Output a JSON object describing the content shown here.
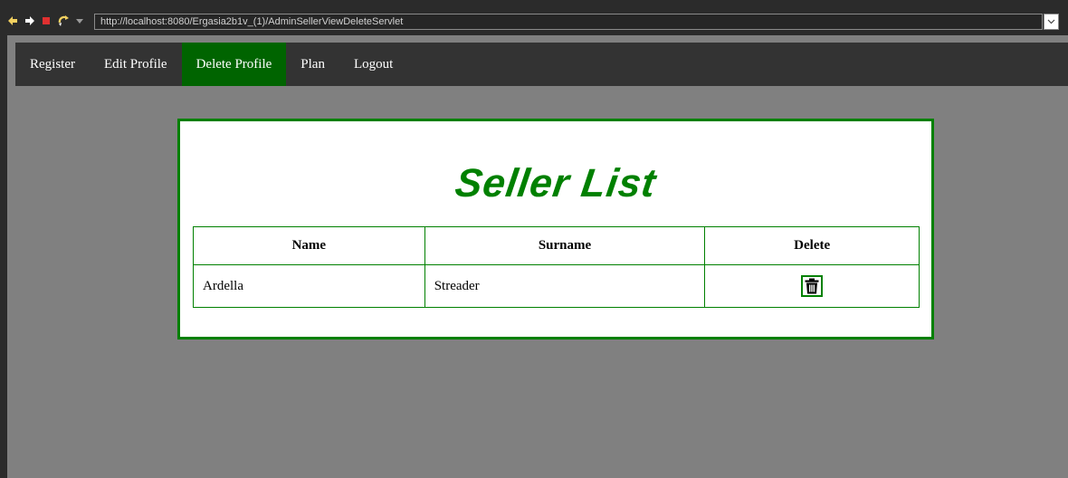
{
  "browser": {
    "url": "http://localhost:8080/Ergasia2b1v_(1)/AdminSellerViewDeleteServlet",
    "icons": [
      "back-arrow-icon",
      "forward-arrow-icon",
      "stop-icon",
      "refresh-icon",
      "dropdown-arrow-icon"
    ]
  },
  "navbar": {
    "items": [
      {
        "label": "Register",
        "active": false
      },
      {
        "label": "Edit Profile",
        "active": false
      },
      {
        "label": "Delete Profile",
        "active": true
      },
      {
        "label": "Plan",
        "active": false
      },
      {
        "label": "Logout",
        "active": false
      }
    ]
  },
  "card": {
    "title": "Seller List",
    "table": {
      "headers": [
        "Name",
        "Surname",
        "Delete"
      ],
      "rows": [
        {
          "name": "Ardella",
          "surname": "Streader",
          "delete_icon": "trash-icon"
        }
      ]
    }
  },
  "colors": {
    "accent": "#008000",
    "active_nav": "#006400",
    "navbar_bg": "#333333",
    "page_bg": "#808080"
  }
}
